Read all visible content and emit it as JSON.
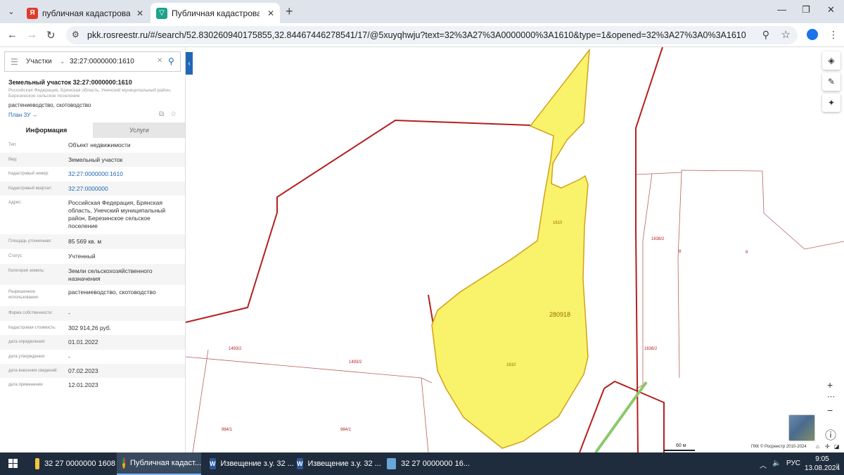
{
  "browser": {
    "tabs": [
      {
        "title": "публичная кадастровая карта",
        "icon": "yandex-icon"
      },
      {
        "title": "Публичная кадастровая карта",
        "icon": "rosreestr-icon"
      }
    ],
    "url": "pkk.rosreestr.ru/#/search/52.830260940175855,32.84467446278541/17/@5xuyqhwju?text=32%3A27%3A0000000%3A1610&type=1&opened=32%3A27%3A0%3A1610"
  },
  "panel": {
    "search_type": "Участки",
    "search_value": "32:27:0000000:1610",
    "title": "Земельный участок 32:27:0000000:1610",
    "subtitle": "Российская Федерация, Брянская область, Унечский муниципальный район, Березинское сельское поселение",
    "use": "растениеводство, скотоводство",
    "plan_link": "План ЗУ →",
    "tabs": [
      "Информация",
      "Услуги"
    ],
    "rows": [
      {
        "label": "Тип:",
        "value": "Объект недвижимости"
      },
      {
        "label": "Вид:",
        "value": "Земельный участок"
      },
      {
        "label": "Кадастровый номер:",
        "value": "32:27:0000000:1610"
      },
      {
        "label": "Кадастровый квартал:",
        "value": "32:27:0000000"
      },
      {
        "label": "Адрес:",
        "value": "Российская Федерация, Брянская область, Унечский муниципальный район, Березинское сельское поселение"
      },
      {
        "label": "Площадь уточненная:",
        "value": "85 569 кв. м"
      },
      {
        "label": "Статус:",
        "value": "Учтенный"
      },
      {
        "label": "Категория земель:",
        "value": "Земли сельскохозяйственного назначения"
      },
      {
        "label": "Разрешенное использование:",
        "value": "растениеводство, скотоводство"
      },
      {
        "label": "Форма собственности:",
        "value": "-"
      },
      {
        "label": "Кадастровая стоимость:",
        "value": "302 914,26 руб."
      },
      {
        "label": "дата определения:",
        "value": "01.01.2022"
      },
      {
        "label": "дата утверждения:",
        "value": "-"
      },
      {
        "label": "дата внесения сведений:",
        "value": "07.02.2023"
      },
      {
        "label": "дата применения:",
        "value": "12.01.2023"
      }
    ]
  },
  "map": {
    "labels": [
      "1610",
      "280918",
      "1610",
      "1638/2",
      "8",
      "8",
      "1638/2",
      "1493/2",
      "1493/2",
      "984/1",
      "984/1"
    ],
    "scale": "60 м",
    "attribution": "ПКК © Росреестр 2010-2024",
    "colors": {
      "parcel_fill": "#f8f36a",
      "parcel_border": "#d4a017",
      "boundary": "#b51f1f",
      "road": "#8bc86a"
    }
  },
  "taskbar": {
    "items": [
      {
        "label": "32 27 0000000 1608",
        "icon": "folder-icon"
      },
      {
        "label": "Публичная кадаст...",
        "icon": "chrome-icon"
      },
      {
        "label": "Извещение з.у. 32 ...",
        "icon": "word-icon"
      },
      {
        "label": "Извещение з.у. 32 ...",
        "icon": "word-icon"
      },
      {
        "label": "32  27  0000000  16...",
        "icon": "image-icon"
      }
    ],
    "lang": "РУС",
    "time": "9:05",
    "date": "13.08.2024"
  }
}
